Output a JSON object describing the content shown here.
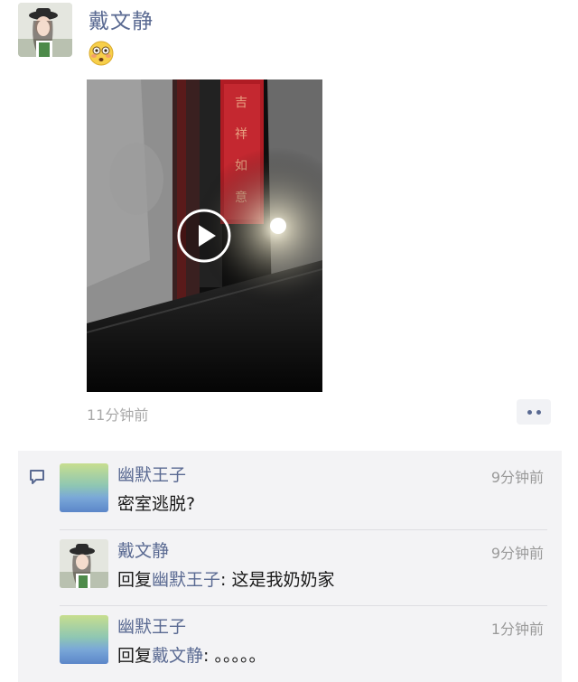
{
  "post": {
    "author": "戴文静",
    "emoji_icon": "flushed-face-emoji",
    "video_icon": "play-icon",
    "time": "11分钟前",
    "more_icon": "more-dots-icon"
  },
  "comments": [
    {
      "name": "幽默王子",
      "time": "9分钟前",
      "text": "密室逃脱?",
      "avatar": "gradient-avatar"
    },
    {
      "name": "戴文静",
      "time": "9分钟前",
      "reply_prefix": "回复",
      "reply_to": "幽默王子",
      "reply_sep": ": ",
      "text": "这是我奶奶家",
      "avatar": "photo-avatar"
    },
    {
      "name": "幽默王子",
      "time": "1分钟前",
      "reply_prefix": "回复",
      "reply_to": "戴文静",
      "reply_sep": ": ",
      "text": "。。。。。",
      "avatar": "gradient-avatar"
    }
  ],
  "colors": {
    "link": "#5a6a92",
    "timestamp": "#a8a8a8",
    "comments_bg": "#f3f3f5"
  }
}
